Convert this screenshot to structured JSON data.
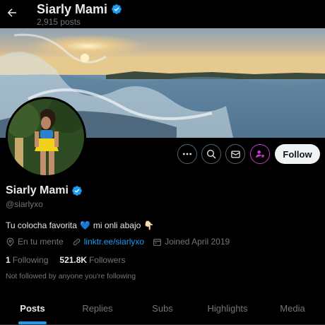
{
  "header": {
    "title": "Siarly Mami",
    "posts_count": "2,915 posts",
    "back_icon": "arrow-left-icon"
  },
  "profile": {
    "display_name": "Siarly Mami",
    "handle": "@siarlyxo",
    "bio_part1": "Tu colocha favorita",
    "bio_emoji1": "💙",
    "bio_part2": "mi onli abajo",
    "bio_emoji2": "👇🏻",
    "location": "En tu mente",
    "website": "linktr.ee/siarlyxo",
    "joined": "Joined April 2019",
    "following_count": "1",
    "following_label": "Following",
    "followers_count": "521.8K",
    "followers_label": "Followers",
    "followed_by": "Not followed by anyone you're following"
  },
  "actions": {
    "follow_label": "Follow",
    "more_icon": "more-icon",
    "search_icon": "search-icon",
    "message_icon": "envelope-icon",
    "subscribe_icon": "subscribe-icon"
  },
  "tabs": [
    {
      "label": "Posts",
      "active": true
    },
    {
      "label": "Replies",
      "active": false
    },
    {
      "label": "Subs",
      "active": false
    },
    {
      "label": "Highlights",
      "active": false
    },
    {
      "label": "Media",
      "active": false
    }
  ],
  "colors": {
    "accent": "#1d9bf0",
    "background": "#000000",
    "subscribe": "#c936cc"
  }
}
